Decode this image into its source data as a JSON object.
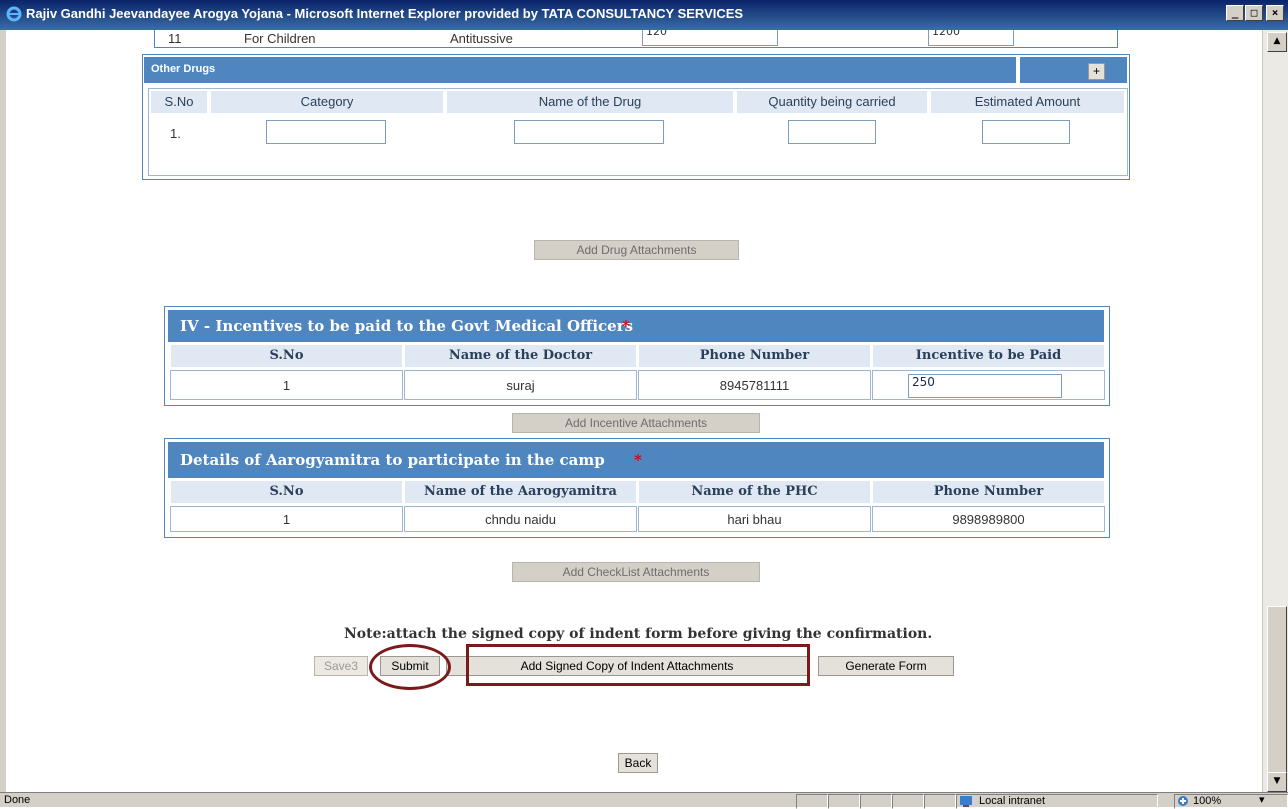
{
  "window": {
    "title": "Rajiv Gandhi Jeevandayee Arogya Yojana - Microsoft Internet Explorer provided by TATA CONSULTANCY SERVICES",
    "minimize": "_",
    "maximize": "□",
    "close": "×"
  },
  "prev_row": {
    "sno": "11",
    "category": "For Children",
    "drug": "Antitussive",
    "qty": "120",
    "amount": "1200"
  },
  "other_drugs": {
    "title": "Other Drugs",
    "add_label": "+",
    "headers": [
      "S.No",
      "Category",
      "Name of the Drug",
      "Quantity being carried",
      "Estimated Amount"
    ],
    "rows": [
      {
        "sno": "1.",
        "category": "",
        "drug": "",
        "qty": "",
        "amount": ""
      }
    ]
  },
  "add_drug_attachments": "Add Drug Attachments",
  "incentives": {
    "title": "IV - Incentives to be paid to the Govt Medical Officers",
    "required_mark": "*",
    "headers": [
      "S.No",
      "Name of the Doctor",
      "Phone Number",
      "Incentive to be Paid"
    ],
    "rows": [
      {
        "sno": "1",
        "doctor": "suraj",
        "phone": "8945781111",
        "incentive": "250"
      }
    ]
  },
  "add_incentive_attachments": "Add Incentive Attachments",
  "aarogyamitra": {
    "title": "Details of Aarogyamitra to participate in the camp",
    "required_mark": "*",
    "headers": [
      "S.No",
      "Name of the Aarogyamitra",
      "Name of the PHC",
      "Phone Number"
    ],
    "rows": [
      {
        "sno": "1",
        "name": "chndu naidu",
        "phc": "hari bhau",
        "phone": "9898989800"
      }
    ]
  },
  "add_checklist_attachments": "Add CheckList Attachments",
  "note": "Note:attach the signed copy of indent form before giving the confirmation.",
  "buttons": {
    "save": "Save3",
    "submit": "Submit",
    "add_signed": "Add Signed Copy of Indent Attachments",
    "generate": "Generate Form",
    "back": "Back"
  },
  "status": {
    "text": "Done",
    "zone": "Local intranet",
    "zoom": "100%"
  },
  "colors": {
    "section_header": "#4f86c0",
    "annotation": "#7a1a1a",
    "required": "#e00000"
  }
}
